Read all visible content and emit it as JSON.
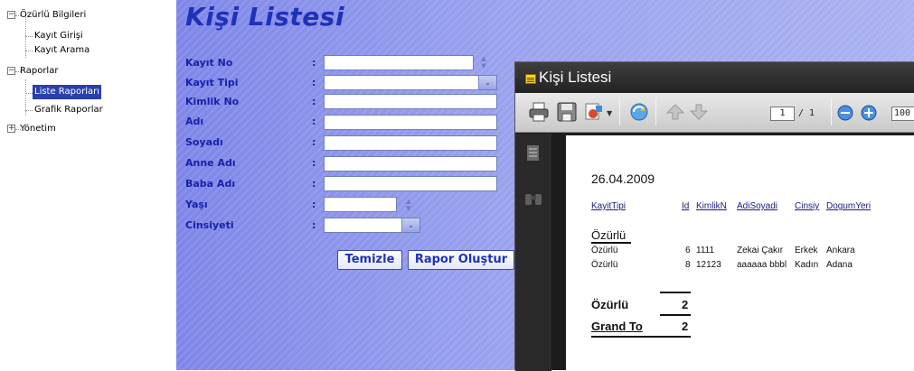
{
  "tree": {
    "nodes": [
      {
        "label": "Özürlü Bilgileri",
        "expander": "−"
      },
      {
        "label": "Kayıt Girişi"
      },
      {
        "label": "Kayıt Arama"
      },
      {
        "label": "Raporlar",
        "expander": "−"
      },
      {
        "label": "Liste Raporları"
      },
      {
        "label": "Grafik Raporlar"
      },
      {
        "label": "Yönetim",
        "expander": "+"
      }
    ]
  },
  "form": {
    "title": "Kişi Listesi",
    "colon": ":",
    "fields": [
      {
        "label": "Kayıt No",
        "value": ""
      },
      {
        "label": "Kayıt Tipi",
        "value": ""
      },
      {
        "label": "Kimlik No",
        "value": ""
      },
      {
        "label": "Adı",
        "value": ""
      },
      {
        "label": "Soyadı",
        "value": ""
      },
      {
        "label": "Anne Adı",
        "value": ""
      },
      {
        "label": "Baba Adı",
        "value": ""
      },
      {
        "label": "Yaşı",
        "value": ""
      },
      {
        "label": "Cinsiyeti",
        "value": ""
      }
    ],
    "clear_button": "Temizle",
    "report_button": "Rapor Oluştur"
  },
  "report_window": {
    "title": "Kişi Listesi",
    "page_current": "1",
    "page_total": "/ 1",
    "zoom": "100",
    "report": {
      "date": "26.04.2009",
      "headers": [
        "KayitTipi",
        "Id",
        "KimlikN",
        "AdiSoyadi",
        "Cinsiy",
        "DogumYeri"
      ],
      "group_name": "Özürlü",
      "rows": [
        {
          "tip": "Özürlü",
          "id": "6",
          "kimlik": "1111",
          "ad": "Zekai Çakır",
          "cins": "Erkek",
          "dogum": "Ankara"
        },
        {
          "tip": "Özürlü",
          "id": "8",
          "kimlik": "12123",
          "ad": "aaaaaa bbbl",
          "cins": "Kadın",
          "dogum": "Adana"
        }
      ],
      "group_total_label": "Özürlü",
      "group_total": "2",
      "grand_label": "Grand To",
      "grand_total": "2"
    }
  },
  "colors": {
    "form_label": "#1822a8",
    "title": "#1f31b9",
    "selection": "#2a3fae"
  }
}
